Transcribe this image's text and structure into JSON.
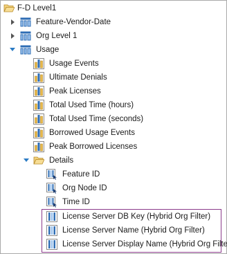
{
  "tree": {
    "root": {
      "label": "F-D Level1"
    },
    "feature_vendor_date": {
      "label": "Feature-Vendor-Date"
    },
    "org_level_1": {
      "label": "Org Level 1"
    },
    "usage": {
      "label": "Usage",
      "measures": [
        {
          "label": "Usage Events"
        },
        {
          "label": "Ultimate Denials"
        },
        {
          "label": "Peak Licenses"
        },
        {
          "label": "Total Used Time (hours)"
        },
        {
          "label": "Total Used Time (seconds)"
        },
        {
          "label": "Borrowed Usage Events"
        },
        {
          "label": "Peak Borrowed Licenses"
        }
      ]
    },
    "details": {
      "label": "Details",
      "items": [
        {
          "label": "Feature ID"
        },
        {
          "label": "Org Node ID"
        },
        {
          "label": "Time ID"
        }
      ],
      "highlighted_items": [
        {
          "label": "License Server DB Key (Hybrid Org Filter)"
        },
        {
          "label": "License Server Name (Hybrid Org Filter)"
        },
        {
          "label": "License Server Display Name (Hybrid Org Filter)"
        }
      ]
    }
  },
  "colors": {
    "highlight_border": "#8b3a8b",
    "folder": "#e8b94a",
    "hierarchy_icon": "#2e6db4"
  },
  "icons": {
    "folder": "folder-icon",
    "hierarchy": "hierarchy-icon",
    "measure": "measure-icon",
    "attribute": "attribute-icon"
  }
}
